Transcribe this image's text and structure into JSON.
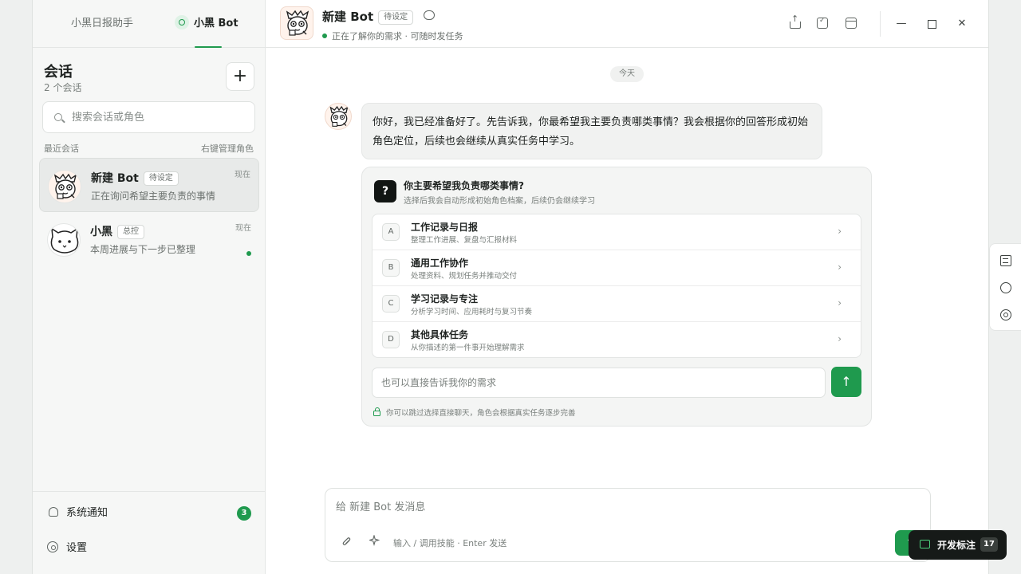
{
  "sidebar": {
    "tabs": [
      "小黑日报助手",
      "小黑 Bot"
    ],
    "title": "会话",
    "count": "2 个会话",
    "add_label": "+",
    "search_placeholder": "搜索会话或角色",
    "recent_label": "最近会话",
    "recent_hint": "右键管理角色",
    "conversations": [
      {
        "name": "新建 Bot",
        "badge": "待设定",
        "subtitle": "正在询问希望主要负责的事情",
        "time": "现在",
        "active": true
      },
      {
        "name": "小黑",
        "badge": "总控",
        "subtitle": "本周进展与下一步已整理",
        "time": "现在",
        "online": true
      }
    ],
    "bottom": {
      "notifications_label": "系统通知",
      "notifications_count": "3",
      "settings_label": "设置"
    }
  },
  "header": {
    "title": "新建 Bot",
    "badge": "待设定",
    "status": "正在了解你的需求 · 可随时发任务",
    "window_min": "—",
    "window_close": "✕"
  },
  "chat": {
    "date": "今天",
    "message": "你好，我已经准备好了。先告诉我，你最希望我主要负责哪类事情？我会根据你的回答形成初始角色定位，后续也会继续从真实任务中学习。",
    "question": {
      "icon": "?",
      "title": "你主要希望我负责哪类事情?",
      "subtitle": "选择后我会自动形成初始角色档案，后续仍会继续学习",
      "options": [
        {
          "letter": "A",
          "title": "工作记录与日报",
          "desc": "整理工作进展、复盘与汇报材料"
        },
        {
          "letter": "B",
          "title": "通用工作协作",
          "desc": "处理资料、规划任务并推动交付"
        },
        {
          "letter": "C",
          "title": "学习记录与专注",
          "desc": "分析学习时间、应用耗时与复习节奏"
        },
        {
          "letter": "D",
          "title": "其他具体任务",
          "desc": "从你描述的第一件事开始理解需求"
        }
      ],
      "chevron": "›",
      "input_placeholder": "也可以直接告诉我你的需求",
      "send_icon": "↑",
      "footer": "你可以跳过选择直接聊天，角色会根据真实任务逐步完善"
    }
  },
  "composer": {
    "placeholder": "给 新建 Bot 发消息",
    "attach_icon": "attach-icon",
    "spark_icon": "sparkle-icon",
    "hint": "输入 / 调用技能 · Enter 发送",
    "send_icon": "↑"
  },
  "dev_pill": {
    "label": "开发标注",
    "count": "17"
  },
  "colors": {
    "accent": "#1f9a4e",
    "dark": "#161a18"
  }
}
